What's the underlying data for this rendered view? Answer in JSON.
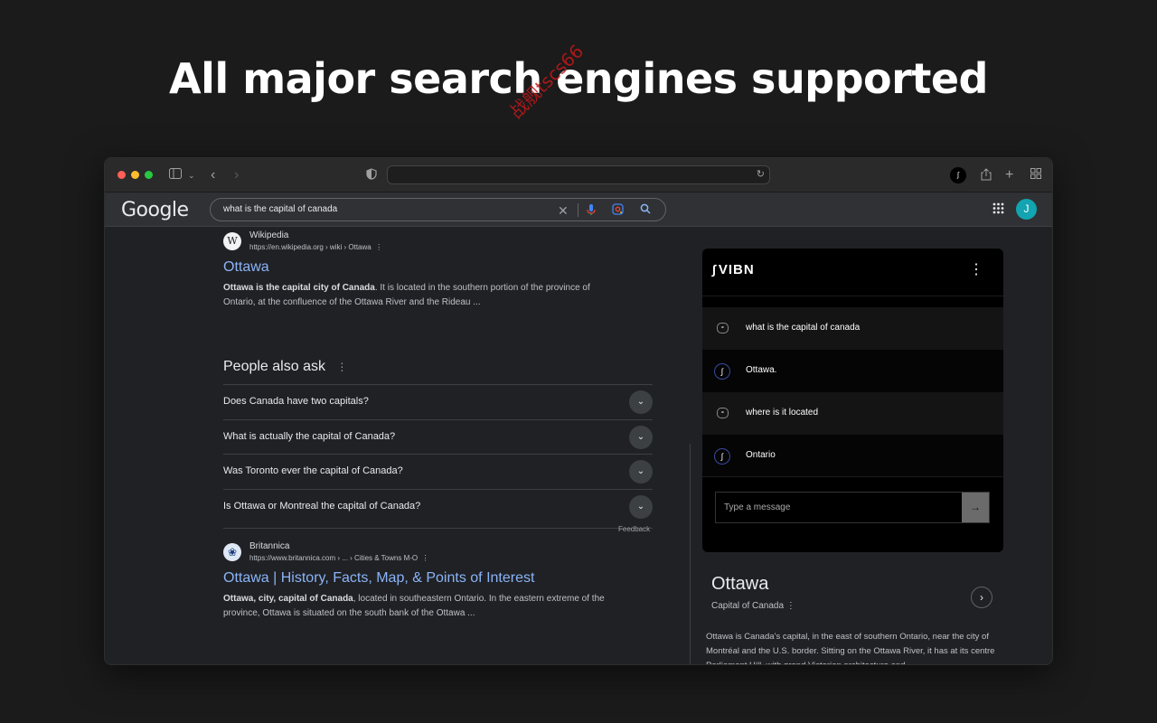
{
  "headline": "All major search engines supported",
  "watermark": "战舰tscs66",
  "browser": {
    "traffic_colors": [
      "#ff5f57",
      "#febc2e",
      "#28c840"
    ]
  },
  "google": {
    "logo": "Google",
    "query": "what is the capital of canada",
    "avatar_initial": "J"
  },
  "results": [
    {
      "favicon": "W",
      "site": "Wikipedia",
      "url": "https://en.wikipedia.org › wiki › Ottawa",
      "title": "Ottawa",
      "snippet_bold": "Ottawa is the capital city of Canada",
      "snippet_rest": ". It is located in the southern portion of the province of Ontario, at the confluence of the Ottawa River and the Rideau ..."
    },
    {
      "favicon": "❀",
      "site": "Britannica",
      "url": "https://www.britannica.com › ... › Cities & Towns M-O",
      "title": "Ottawa | History, Facts, Map, & Points of Interest",
      "snippet_bold": "Ottawa, city, capital of Canada",
      "snippet_rest": ", located in southeastern Ontario. In the eastern extreme of the province, Ottawa is situated on the south bank of the Ottawa ..."
    }
  ],
  "people_also_ask": {
    "title": "People also ask",
    "questions": [
      "Does Canada have two capitals?",
      "What is actually the capital of Canada?",
      "Was Toronto ever the capital of Canada?",
      "Is Ottawa or Montreal the capital of Canada?"
    ],
    "feedback": "Feedback"
  },
  "vibn": {
    "logo": "VIBN",
    "messages": [
      {
        "role": "user",
        "text": "what is the capital of canada"
      },
      {
        "role": "bot",
        "text": "Ottawa."
      },
      {
        "role": "user",
        "text": "where is it located"
      },
      {
        "role": "bot",
        "text": "Ontario"
      }
    ],
    "input_placeholder": "Type a message"
  },
  "knowledge_panel": {
    "title": "Ottawa",
    "subtitle": "Capital of Canada",
    "description": "Ottawa is Canada’s capital, in the east of southern Ontario, near the city of Montréal and the U.S. border. Sitting on the Ottawa River, it has at its centre Parliament Hill, with grand Victorian architecture and"
  }
}
